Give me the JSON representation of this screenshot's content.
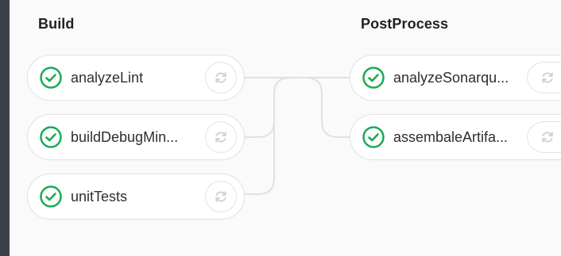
{
  "stages": {
    "build": {
      "title": "Build",
      "jobs": [
        {
          "name": "analyzeLint",
          "status": "success"
        },
        {
          "name": "buildDebugMin...",
          "status": "success"
        },
        {
          "name": "unitTests",
          "status": "success"
        }
      ]
    },
    "post_process": {
      "title": "PostProcess",
      "jobs": [
        {
          "name": "analyzeSonarqu...",
          "status": "success"
        },
        {
          "name": "assembaleArtifa...",
          "status": "success"
        }
      ]
    }
  },
  "colors": {
    "success": "#1aaa55",
    "connector": "#e1e1e1",
    "retry_icon": "#d0d0d0"
  },
  "icons": {
    "status": "check-circle-icon",
    "retry": "retry-icon"
  }
}
